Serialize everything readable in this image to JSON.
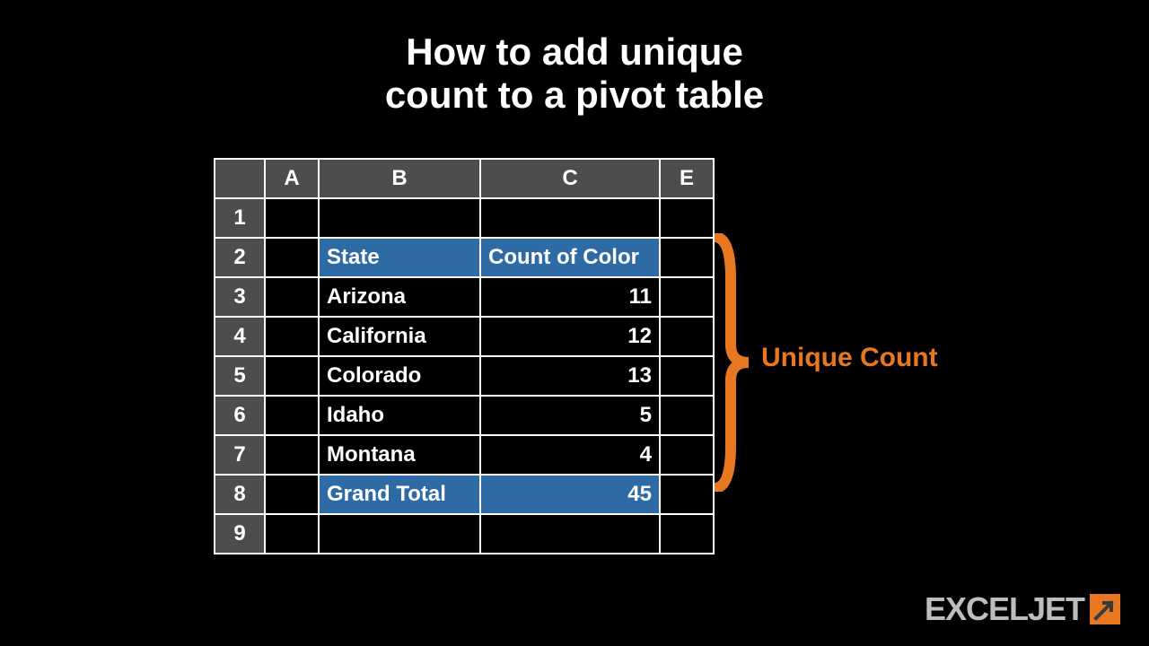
{
  "title_line1": "How to add unique",
  "title_line2": "count to a pivot table",
  "columns": {
    "a": "A",
    "b": "B",
    "c": "C",
    "e": "E"
  },
  "rownums": [
    "1",
    "2",
    "3",
    "4",
    "5",
    "6",
    "7",
    "8",
    "9"
  ],
  "pivot": {
    "header_state": "State",
    "header_count": "Count of Color",
    "rows": [
      {
        "state": "Arizona",
        "count": "11"
      },
      {
        "state": "California",
        "count": "12"
      },
      {
        "state": "Colorado",
        "count": "13"
      },
      {
        "state": "Idaho",
        "count": "5"
      },
      {
        "state": "Montana",
        "count": "4"
      }
    ],
    "total_label": "Grand Total",
    "total_value": "45"
  },
  "callout": "Unique Count",
  "logo": {
    "part1": "EXCEL",
    "part2": "JET"
  },
  "colors": {
    "accent": "#e87722",
    "header": "#4d4d4d",
    "pivot": "#2e6ba4"
  },
  "chart_data": {
    "type": "table",
    "title": "Count of Color by State (pivot table)",
    "columns": [
      "State",
      "Count of Color"
    ],
    "rows": [
      [
        "Arizona",
        11
      ],
      [
        "California",
        12
      ],
      [
        "Colorado",
        13
      ],
      [
        "Idaho",
        5
      ],
      [
        "Montana",
        4
      ]
    ],
    "totals": {
      "label": "Grand Total",
      "value": 45
    }
  }
}
